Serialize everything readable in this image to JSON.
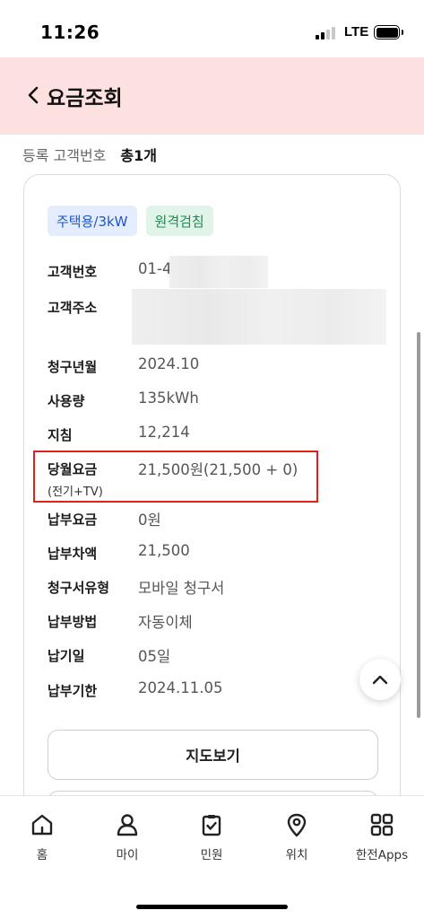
{
  "status_bar": {
    "time": "11:26",
    "network": "LTE"
  },
  "header": {
    "title": "요금조회"
  },
  "summary": {
    "label": "등록 고객번호",
    "count": "총1개"
  },
  "card": {
    "badges": [
      "주택용/3kW",
      "원격검침"
    ],
    "customer_no": {
      "label": "고객번호",
      "value": "01-4"
    },
    "address": {
      "label": "고객주소"
    },
    "billing_month": {
      "label": "청구년월",
      "value": "2024.10"
    },
    "usage": {
      "label": "사용량",
      "value": "135kWh"
    },
    "meter": {
      "label": "지침",
      "value": "12,214"
    },
    "monthly_charge": {
      "label": "당월요금",
      "sub": "(전기+TV)",
      "value": "21,500원(21,500 + 0)"
    },
    "paid": {
      "label": "납부요금",
      "value": "0원"
    },
    "balance": {
      "label": "납부차액",
      "value": "21,500"
    },
    "bill_type": {
      "label": "청구서유형",
      "value": "모바일 청구서"
    },
    "pay_method": {
      "label": "납부방법",
      "value": "자동이체"
    },
    "pay_day": {
      "label": "납기일",
      "value": "05일"
    },
    "due_date": {
      "label": "납부기한",
      "value": "2024.11.05"
    },
    "map_button": "지도보기"
  },
  "nav": {
    "items": [
      {
        "label": "홈",
        "icon": "home-icon"
      },
      {
        "label": "마이",
        "icon": "person-icon"
      },
      {
        "label": "민원",
        "icon": "clipboard-check-icon"
      },
      {
        "label": "위치",
        "icon": "location-pin-icon"
      },
      {
        "label": "한전Apps",
        "icon": "apps-grid-icon"
      }
    ]
  },
  "colors": {
    "header_bg": "#fde0e0",
    "highlight": "#e0201f",
    "badge_blue": "#1f55c9",
    "badge_green": "#1a8a4c"
  }
}
